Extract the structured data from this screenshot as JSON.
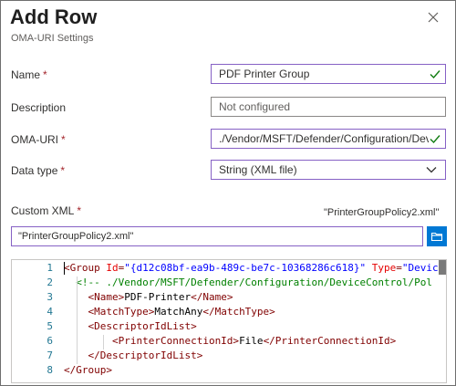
{
  "header": {
    "title": "Add Row",
    "subtitle": "OMA-URI Settings"
  },
  "form": {
    "name": {
      "label": "Name",
      "required": "*",
      "value": "PDF Printer Group"
    },
    "description": {
      "label": "Description",
      "placeholder": "Not configured"
    },
    "oma_uri": {
      "label": "OMA-URI",
      "required": "*",
      "value": "./Vendor/MSFT/Defender/Configuration/Dev..."
    },
    "data_type": {
      "label": "Data type",
      "required": "*",
      "value": "String (XML file)"
    },
    "custom_xml": {
      "label": "Custom XML",
      "required": "*",
      "file_name": "\"PrinterGroupPolicy2.xml\"",
      "input_value": "\"PrinterGroupPolicy2.xml\""
    }
  },
  "editor": {
    "lines": [
      {
        "number": "1",
        "parts": [
          {
            "c": "t",
            "s": "<Group "
          },
          {
            "c": "an",
            "s": "Id"
          },
          {
            "c": "t",
            "s": "="
          },
          {
            "c": "av",
            "s": "\"{d12c08bf-ea9b-489c-be7c-10368286c618}\""
          },
          {
            "c": "t",
            "s": " "
          },
          {
            "c": "an",
            "s": "Type"
          },
          {
            "c": "t",
            "s": "="
          },
          {
            "c": "av",
            "s": "\"Devic"
          }
        ]
      },
      {
        "number": "2",
        "parts": [
          {
            "c": "t",
            "s": "  "
          },
          {
            "c": "cm",
            "s": "<!-- ./Vendor/MSFT/Defender/Configuration/DeviceControl/Pol"
          }
        ]
      },
      {
        "number": "3",
        "parts": [
          {
            "c": "t",
            "s": "    <Name>"
          },
          {
            "c": "x",
            "s": "PDF-Printer"
          },
          {
            "c": "t",
            "s": "</Name>"
          }
        ]
      },
      {
        "number": "4",
        "parts": [
          {
            "c": "t",
            "s": "    <MatchType>"
          },
          {
            "c": "x",
            "s": "MatchAny"
          },
          {
            "c": "t",
            "s": "</MatchType>"
          }
        ]
      },
      {
        "number": "5",
        "parts": [
          {
            "c": "t",
            "s": "    <DescriptorIdList>"
          }
        ]
      },
      {
        "number": "6",
        "parts": [
          {
            "c": "t",
            "s": "        <PrinterConnectionId>"
          },
          {
            "c": "x",
            "s": "File"
          },
          {
            "c": "t",
            "s": "</PrinterConnectionId>"
          }
        ]
      },
      {
        "number": "7",
        "parts": [
          {
            "c": "t",
            "s": "    </DescriptorIdList>"
          }
        ]
      },
      {
        "number": "8",
        "parts": [
          {
            "c": "t",
            "s": "</Group>"
          }
        ]
      }
    ]
  },
  "colors": {
    "accent_border": "#8661c5",
    "valid_check": "#107c10",
    "button_blue": "#0078d4",
    "required_star": "#a4262c"
  },
  "icons": {
    "close": "close-icon",
    "valid": "checkmark-icon",
    "dropdown": "chevron-down-icon",
    "browse": "folder-icon"
  }
}
